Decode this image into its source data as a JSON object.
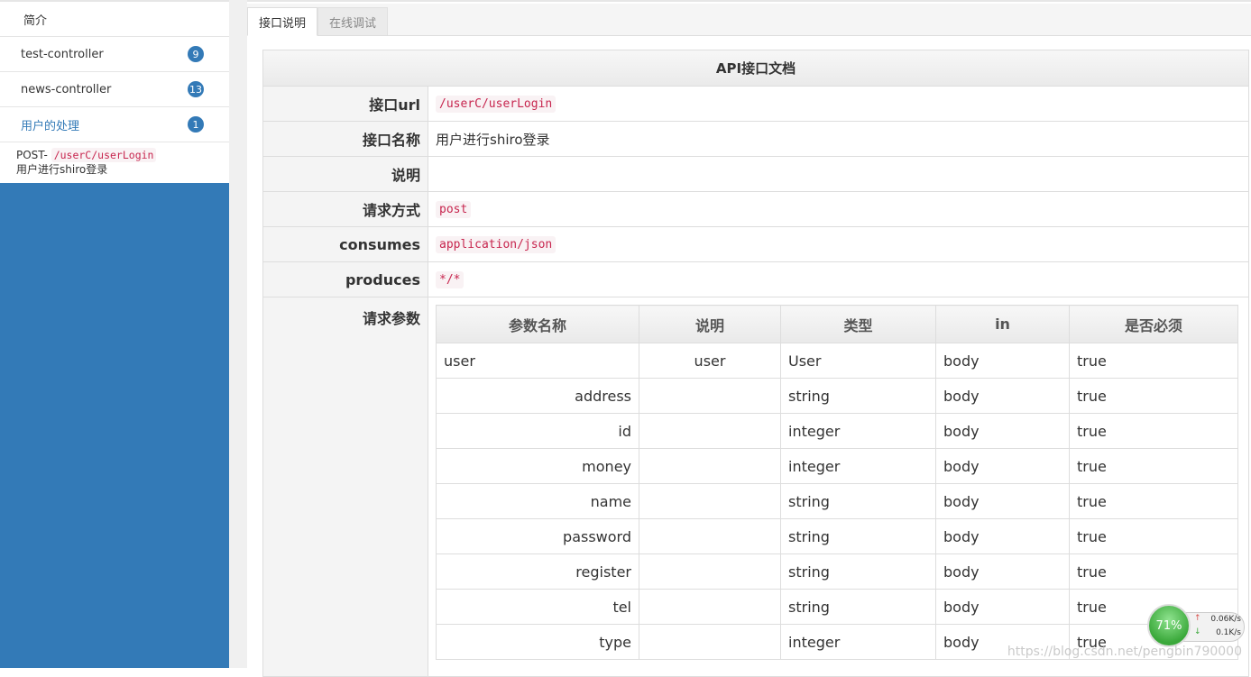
{
  "sidebar": {
    "intro_label": "简介",
    "groups": [
      {
        "label": "test-controller",
        "count": "9"
      },
      {
        "label": "news-controller",
        "count": "13"
      },
      {
        "label": "用户的处理",
        "count": "1"
      }
    ],
    "sub_item": {
      "method": "POST-",
      "path": "/userC/userLogin",
      "desc": "用户进行shiro登录"
    }
  },
  "tabs": {
    "doc": "接口说明",
    "debug": "在线调试"
  },
  "doc": {
    "title": "API接口文档",
    "rows": {
      "url": {
        "key": "接口url",
        "value": "/userC/userLogin"
      },
      "name": {
        "key": "接口名称",
        "value": "用户进行shiro登录"
      },
      "desc": {
        "key": "说明",
        "value": ""
      },
      "method": {
        "key": "请求方式",
        "value": "post"
      },
      "consumes": {
        "key": "consumes",
        "value": "application/json"
      },
      "produces": {
        "key": "produces",
        "value": "*/*"
      },
      "params": {
        "key": "请求参数"
      }
    }
  },
  "params_table": {
    "headers": [
      "参数名称",
      "说明",
      "类型",
      "in",
      "是否必须"
    ],
    "rows": [
      {
        "name": "user",
        "desc": "user",
        "type": "User",
        "in": "body",
        "required": "true"
      },
      {
        "name": "address",
        "desc": "",
        "type": "string",
        "in": "body",
        "required": "true"
      },
      {
        "name": "id",
        "desc": "",
        "type": "integer",
        "in": "body",
        "required": "true"
      },
      {
        "name": "money",
        "desc": "",
        "type": "integer",
        "in": "body",
        "required": "true"
      },
      {
        "name": "name",
        "desc": "",
        "type": "string",
        "in": "body",
        "required": "true"
      },
      {
        "name": "password",
        "desc": "",
        "type": "string",
        "in": "body",
        "required": "true"
      },
      {
        "name": "register",
        "desc": "",
        "type": "string",
        "in": "body",
        "required": "true"
      },
      {
        "name": "tel",
        "desc": "",
        "type": "string",
        "in": "body",
        "required": "true"
      },
      {
        "name": "type",
        "desc": "",
        "type": "integer",
        "in": "body",
        "required": "true"
      }
    ]
  },
  "net_widget": {
    "percent": "71%",
    "up": "0.06K/s",
    "down": "0.1K/s"
  },
  "watermark": "https://blog.csdn.net/pengbin790000",
  "colors": {
    "sidebar_bg": "#337ab7",
    "code_fg": "#c7254e",
    "code_bg": "#f9f2f4"
  }
}
